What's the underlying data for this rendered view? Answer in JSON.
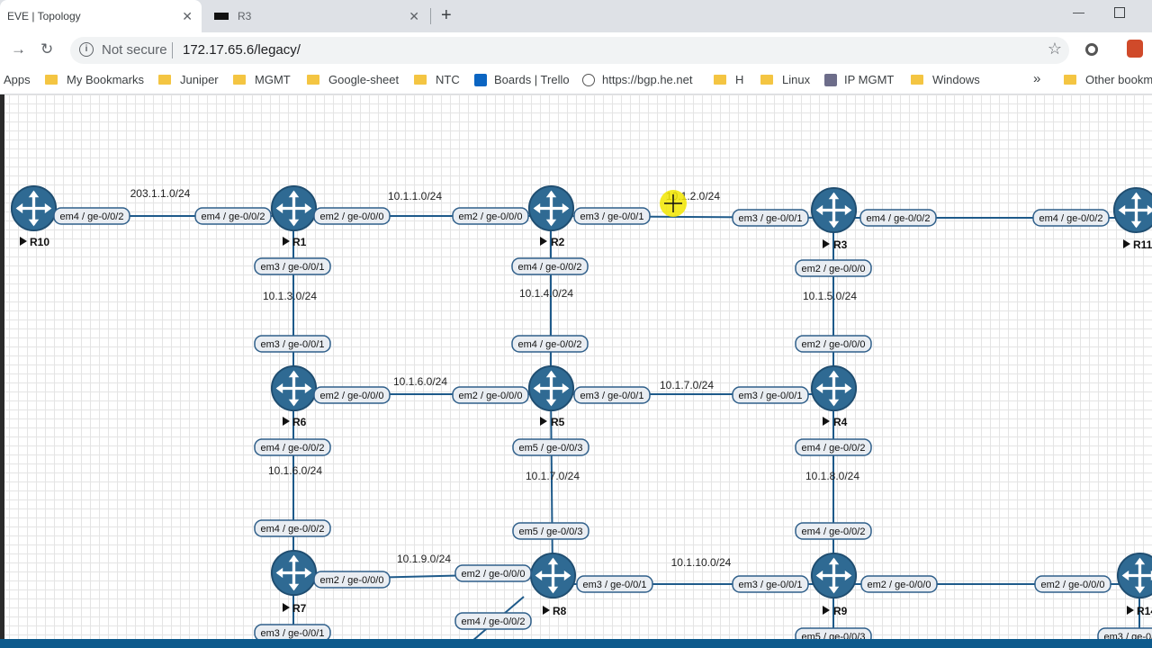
{
  "browser": {
    "tabs": [
      {
        "title": "EVE | Topology",
        "active": true
      },
      {
        "title": "R3",
        "active": false
      }
    ],
    "address": {
      "security": "Not secure",
      "url": "172.17.65.6/legacy/"
    },
    "bookmarks": [
      {
        "label": "Apps",
        "icon": "apps-icon"
      },
      {
        "label": "My Bookmarks",
        "icon": "folder-icon"
      },
      {
        "label": "Juniper",
        "icon": "folder-icon"
      },
      {
        "label": "MGMT",
        "icon": "folder-icon"
      },
      {
        "label": "Google-sheet",
        "icon": "folder-icon"
      },
      {
        "label": "NTC",
        "icon": "folder-icon"
      },
      {
        "label": "Boards | Trello",
        "icon": "trello-icon"
      },
      {
        "label": "https://bgp.he.net",
        "icon": "he-icon"
      },
      {
        "label": "H",
        "icon": "folder-icon"
      },
      {
        "label": "Linux",
        "icon": "folder-icon"
      },
      {
        "label": "IP MGMT",
        "icon": "php-icon"
      },
      {
        "label": "Windows",
        "icon": "folder-icon"
      },
      {
        "label": "»",
        "icon": ""
      },
      {
        "label": "Other bookm",
        "icon": "folder-icon"
      }
    ]
  },
  "topology": {
    "nodes": [
      {
        "name": "R10"
      },
      {
        "name": "R1"
      },
      {
        "name": "R2"
      },
      {
        "name": "R3"
      },
      {
        "name": "R11"
      },
      {
        "name": "R6"
      },
      {
        "name": "R5"
      },
      {
        "name": "R4"
      },
      {
        "name": "R7"
      },
      {
        "name": "R8"
      },
      {
        "name": "R9"
      },
      {
        "name": "R14"
      }
    ],
    "interfaces": [
      "em4 / ge-0/0/2",
      "em4 / ge-0/0/2",
      "em2 / ge-0/0/0",
      "em2 / ge-0/0/0",
      "em3 / ge-0/0/1",
      "em3 / ge-0/0/1",
      "em4 / ge-0/0/2",
      "em4 / ge-0/0/2",
      "em3 / ge-0/0/1",
      "em3 / ge-0/0/1",
      "em4 / ge-0/0/2",
      "em4 / ge-0/0/2",
      "em2 / ge-0/0/0",
      "em2 / ge-0/0/0",
      "em2 / ge-0/0/0",
      "em2 / ge-0/0/0",
      "em3 / ge-0/0/1",
      "em3 / ge-0/0/1",
      "em4 / ge-0/0/2",
      "em4 / ge-0/0/2",
      "em5 / ge-0/0/3",
      "em5 / ge-0/0/3",
      "em4 / ge-0/0/2",
      "em4 / ge-0/0/2",
      "em2 / ge-0/0/0",
      "em2 / ge-0/0/0",
      "em3 / ge-0/0/1",
      "em3 / ge-0/0/1",
      "em2 / ge-0/0/0",
      "em2 / ge-0/0/0",
      "em3 / ge-0/0/1",
      "em4 / ge-0/0/2",
      "em5 / ge-0/0/3",
      "em3 / ge-0/0/1"
    ],
    "networks": [
      "203.1.1.0/24",
      "10.1.1.0/24",
      "10.1.2.0/24",
      "10.1.3.0/24",
      "10.1.4.0/24",
      "10.1.5.0/24",
      "10.1.6.0/24",
      "10.1.7.0/24",
      "10.1.6.0/24",
      "10.1.7.0/24",
      "10.1.8.0/24",
      "10.1.9.0/24",
      "10.1.10.0/24"
    ]
  }
}
